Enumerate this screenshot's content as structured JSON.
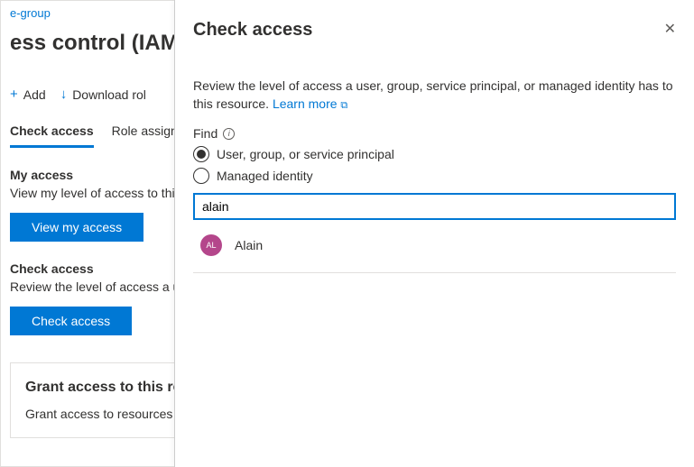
{
  "breadcrumb": {
    "text": "e-group"
  },
  "page": {
    "title": "ess control (IAM)"
  },
  "toolbar": {
    "add": {
      "icon": "+",
      "label": "Add"
    },
    "download": {
      "icon": "↓",
      "label": "Download rol"
    }
  },
  "tabs": {
    "check_access": "Check access",
    "role_assign": "Role assign"
  },
  "my_access": {
    "heading": "My access",
    "desc": "View my level of access to this",
    "button": "View my access"
  },
  "check_access_section": {
    "heading": "Check access",
    "desc": "Review the level of access a u",
    "button": "Check access"
  },
  "grant_card": {
    "heading": "Grant access to this re",
    "desc": "Grant access to resources b"
  },
  "panel": {
    "title": "Check access",
    "desc_prefix": "Review the level of access a user, group, service principal, or managed identity has to this resource. ",
    "learn_more": "Learn more",
    "find_label": "Find",
    "option_user": "User, group, or service principal",
    "option_managed": "Managed identity",
    "search_value": "alain",
    "result": {
      "initials": "AL",
      "name": "Alain"
    }
  }
}
